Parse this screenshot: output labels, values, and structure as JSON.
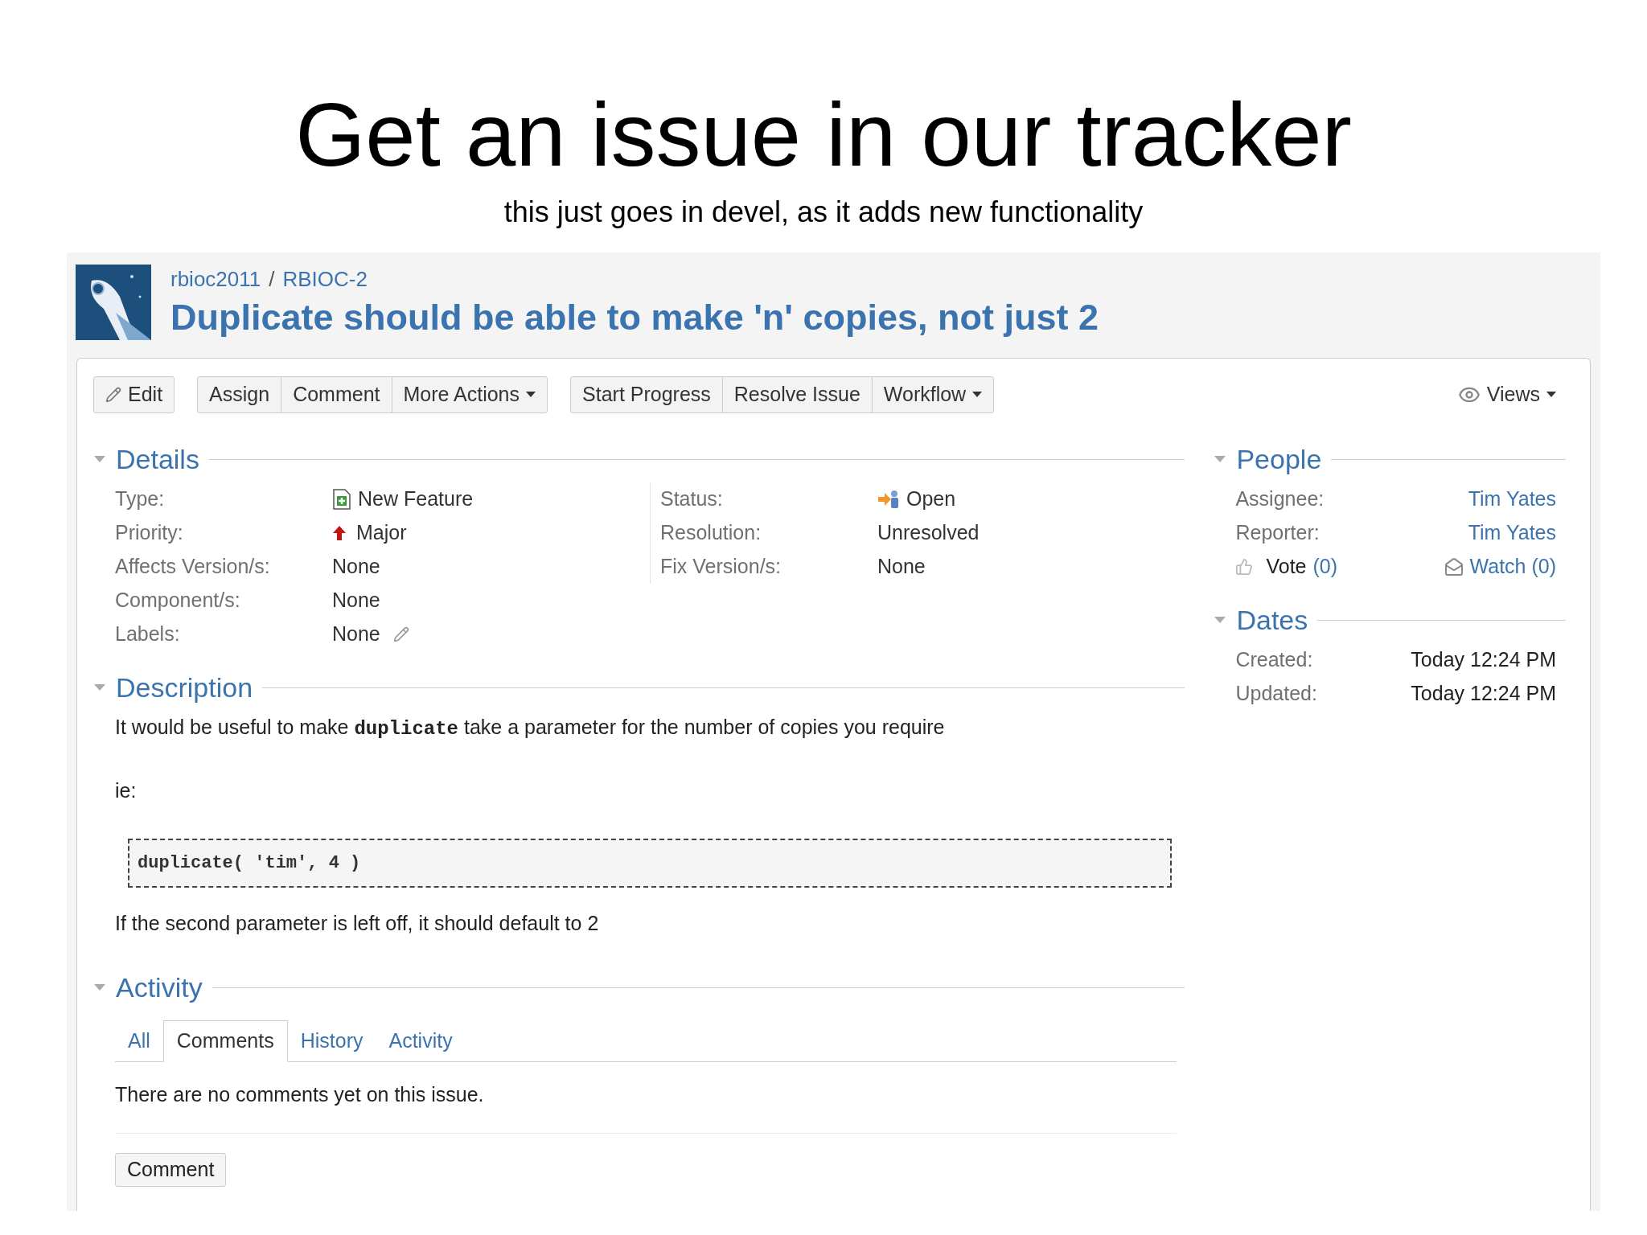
{
  "slide": {
    "title": "Get an issue in our tracker",
    "subtitle": "this just goes in devel, as it adds new functionality"
  },
  "issue": {
    "breadcrumb": [
      "rbioc2011",
      "RBIOC-2"
    ],
    "separator": "/",
    "summary": "Duplicate should be able to make 'n' copies, not just 2"
  },
  "toolbar": {
    "groups": [
      [
        {
          "label": "Edit",
          "kind": "edit",
          "dropdown": false
        }
      ],
      [
        {
          "label": "Assign",
          "kind": "plain",
          "dropdown": false
        },
        {
          "label": "Comment",
          "kind": "plain",
          "dropdown": false
        },
        {
          "label": "More Actions",
          "kind": "plain",
          "dropdown": true
        }
      ],
      [
        {
          "label": "Start Progress",
          "kind": "plain",
          "dropdown": false
        },
        {
          "label": "Resolve Issue",
          "kind": "plain",
          "dropdown": false
        },
        {
          "label": "Workflow",
          "kind": "plain",
          "dropdown": true
        }
      ]
    ],
    "views": {
      "label": "Views",
      "dropdown": true
    }
  },
  "details": {
    "title": "Details",
    "expanded": true,
    "left": [
      {
        "label": "Type:",
        "value": "New Feature",
        "kind": "type"
      },
      {
        "label": "Priority:",
        "value": "Major",
        "kind": "priority"
      },
      {
        "label": "Affects Version/s:",
        "value": "None",
        "kind": "text"
      },
      {
        "label": "Component/s:",
        "value": "None",
        "kind": "text"
      },
      {
        "label": "Labels:",
        "value": "None",
        "kind": "editable"
      }
    ],
    "right": [
      {
        "label": "Status:",
        "value": "Open",
        "kind": "status"
      },
      {
        "label": "Resolution:",
        "value": "Unresolved",
        "kind": "text"
      },
      {
        "label": "Fix Version/s:",
        "value": "None",
        "kind": "text"
      }
    ]
  },
  "description": {
    "title": "Description",
    "expanded": true,
    "paragraphs": [
      {
        "kind": "text",
        "segments": [
          {
            "kind": "text",
            "text": "It would be useful to make "
          },
          {
            "kind": "code",
            "text": "duplicate"
          },
          {
            "kind": "text",
            "text": " take a parameter for the number of copies you require"
          }
        ]
      },
      {
        "kind": "text",
        "segments": [
          {
            "kind": "text",
            "text": "ie:"
          }
        ]
      },
      {
        "kind": "code",
        "text": "duplicate( 'tim', 4 )"
      },
      {
        "kind": "text",
        "segments": [
          {
            "kind": "text",
            "text": "If the second parameter is left off, it should default to 2"
          }
        ]
      }
    ]
  },
  "activity": {
    "title": "Activity",
    "expanded": true,
    "tabs": [
      {
        "label": "All",
        "selected": false
      },
      {
        "label": "Comments",
        "selected": true
      },
      {
        "label": "History",
        "selected": false
      },
      {
        "label": "Activity",
        "selected": false
      }
    ],
    "message": "There are no comments yet on this issue.",
    "button": "Comment"
  },
  "people": {
    "title": "People",
    "expanded": true,
    "rows": [
      {
        "label": "Assignee:",
        "value": "Tim Yates"
      },
      {
        "label": "Reporter:",
        "value": "Tim Yates"
      }
    ],
    "vote": {
      "label": "Vote",
      "count": "(0)"
    },
    "watch": {
      "label": "Watch (0)"
    }
  },
  "dates": {
    "title": "Dates",
    "expanded": true,
    "rows": [
      {
        "label": "Created:",
        "value": "Today 12:24 PM"
      },
      {
        "label": "Updated:",
        "value": "Today 12:24 PM"
      }
    ]
  }
}
